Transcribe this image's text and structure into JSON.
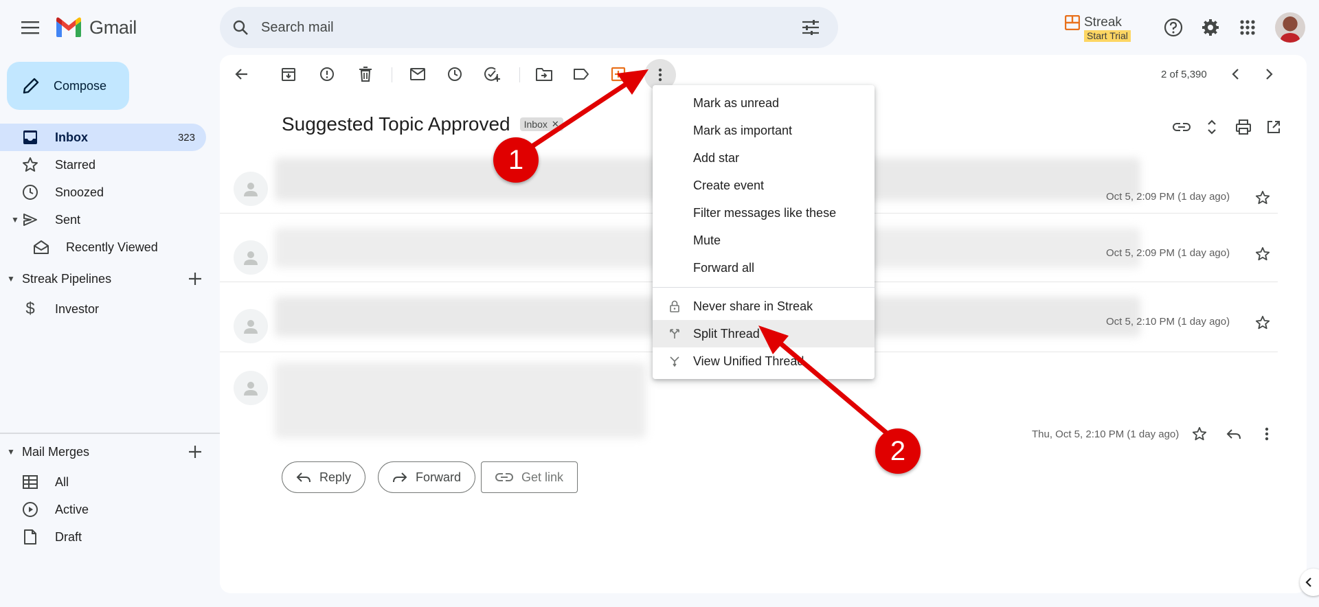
{
  "app": {
    "name": "Gmail"
  },
  "search": {
    "placeholder": "Search mail"
  },
  "streak": {
    "name": "Streak",
    "trial": "Start Trial"
  },
  "sidebar": {
    "compose": "Compose",
    "items": [
      {
        "label": "Inbox",
        "count": "323",
        "icon": "inbox-icon"
      },
      {
        "label": "Starred",
        "icon": "star-icon"
      },
      {
        "label": "Snoozed",
        "icon": "clock-icon"
      },
      {
        "label": "Sent",
        "icon": "send-icon"
      },
      {
        "label": "Recently Viewed",
        "icon": "open-mail-icon"
      }
    ],
    "streak_pipelines": {
      "title": "Streak Pipelines",
      "items": [
        {
          "label": "Investor",
          "icon": "dollar-icon"
        }
      ]
    },
    "mail_merges": {
      "title": "Mail Merges",
      "items": [
        {
          "label": "All",
          "icon": "table-icon"
        },
        {
          "label": "Active",
          "icon": "play-circle-icon"
        },
        {
          "label": "Draft",
          "icon": "document-icon"
        }
      ]
    }
  },
  "toolbar": {
    "pager": "2 of 5,390"
  },
  "thread": {
    "subject": "Suggested Topic Approved",
    "label": "Inbox",
    "messages": [
      {
        "date": "Oct 5, 2:09 PM (1 day ago)"
      },
      {
        "date": "Oct 5, 2:09 PM (1 day ago)"
      },
      {
        "date": "Oct 5, 2:10 PM (1 day ago)"
      },
      {
        "date": "Thu, Oct 5, 2:10 PM (1 day ago)"
      }
    ]
  },
  "actions": {
    "reply": "Reply",
    "forward": "Forward",
    "get_link": "Get link"
  },
  "menu": {
    "items": [
      "Mark as unread",
      "Mark as important",
      "Add star",
      "Create event",
      "Filter messages like these",
      "Mute",
      "Forward all"
    ],
    "streak_items": [
      {
        "label": "Never share in Streak",
        "icon": "lock-icon"
      },
      {
        "label": "Split Thread",
        "icon": "split-icon"
      },
      {
        "label": "View Unified Thread",
        "icon": "merge-icon"
      }
    ]
  },
  "annotations": {
    "step1": "1",
    "step2": "2",
    "color": "#e00000"
  }
}
